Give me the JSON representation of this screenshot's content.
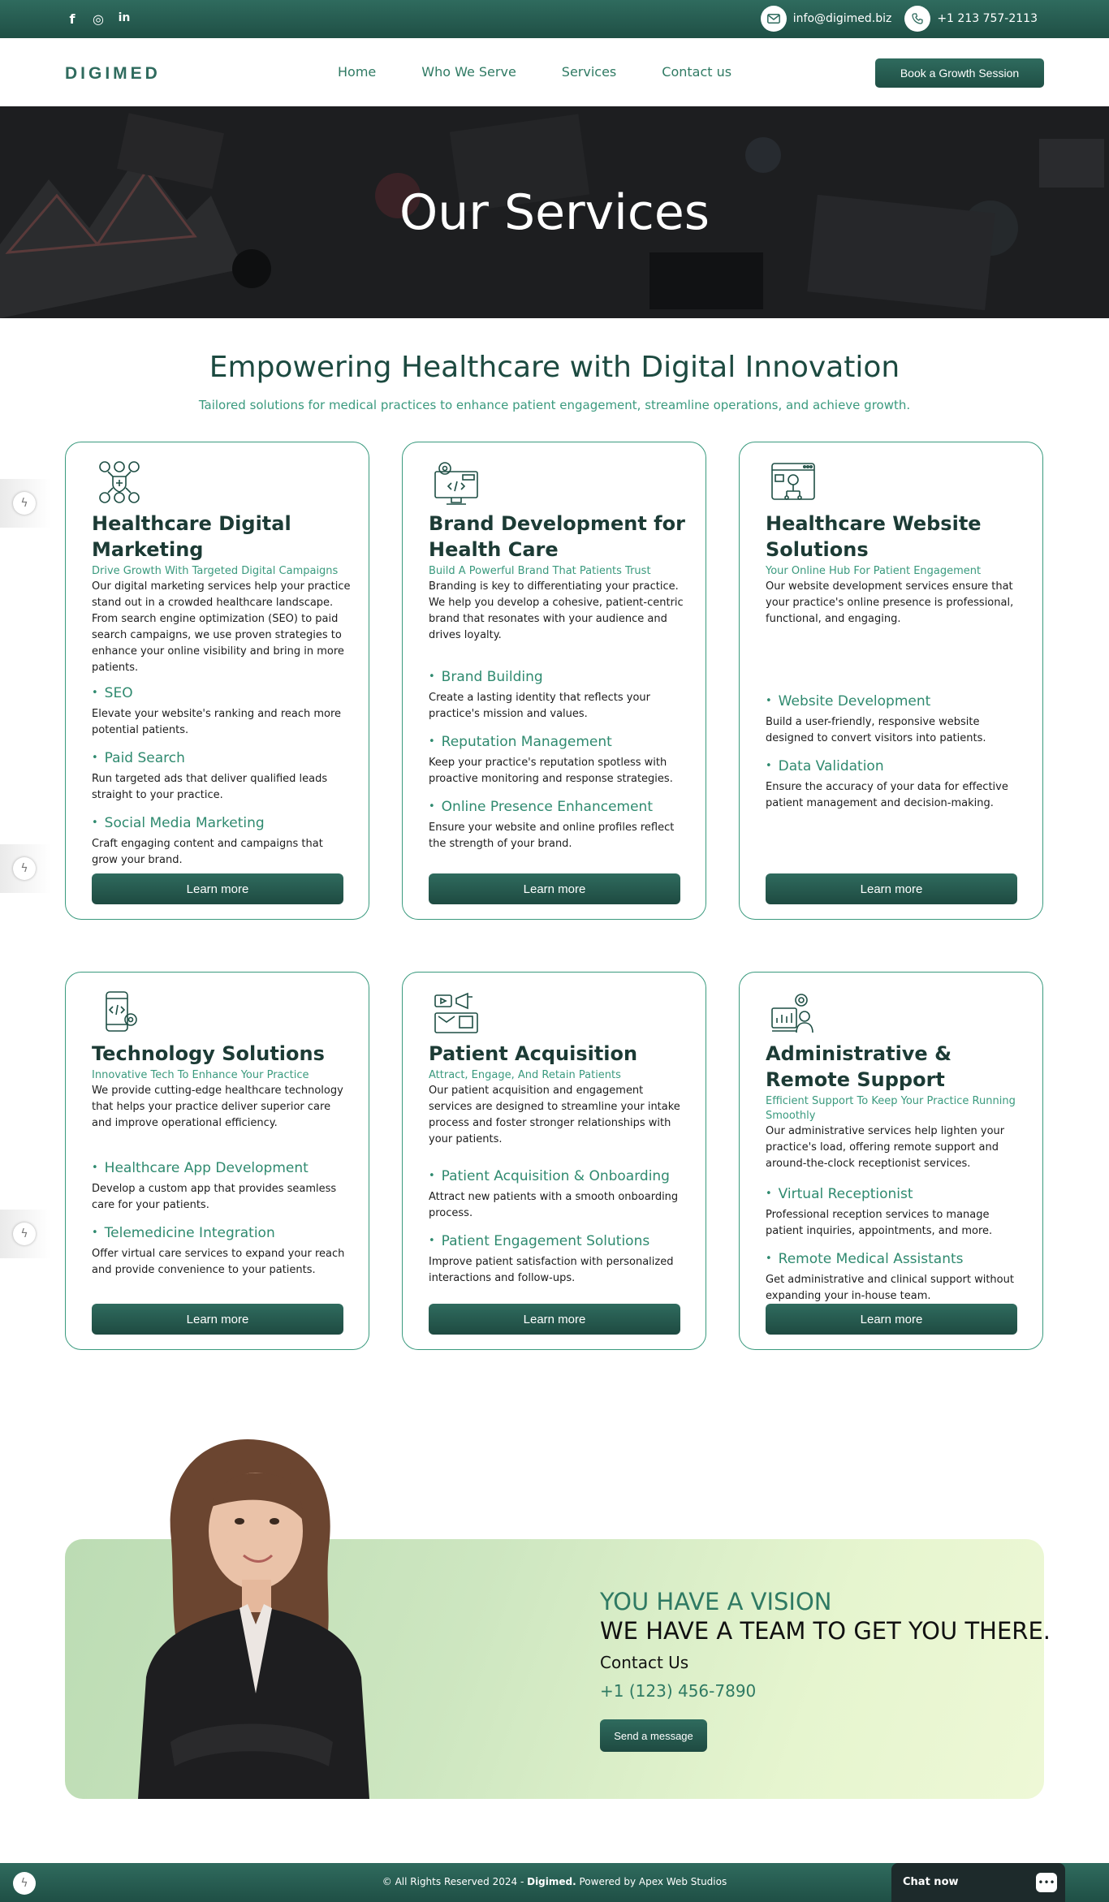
{
  "topbar": {
    "social": [
      {
        "icon": "facebook-icon",
        "glyph": "f"
      },
      {
        "icon": "instagram-icon",
        "glyph": "◎"
      },
      {
        "icon": "linkedin-icon",
        "glyph": "in"
      }
    ],
    "email": "info@digimed.biz",
    "phone": "+1 213 757-2113"
  },
  "navbar": {
    "logo": "DIGIMED",
    "links": [
      "Home",
      "Who We Serve",
      "Services",
      "Contact us"
    ],
    "cta_label": "Book a Growth Session"
  },
  "hero": {
    "title": "Our Services"
  },
  "intro": {
    "title": "Empowering Healthcare with Digital Innovation",
    "subtitle": "Tailored solutions for medical practices to enhance patient engagement, streamline operations, and achieve growth."
  },
  "cards": [
    {
      "icon": "digital-marketing-icon",
      "title": "Healthcare Digital Marketing",
      "subtitle": "Drive Growth With Targeted Digital Campaigns",
      "description": "Our digital marketing services help your practice stand out in a crowded healthcare landscape. From search engine optimization (SEO) to paid search campaigns, we use proven strategies to enhance your online visibility and bring in more patients.",
      "features": [
        {
          "title": "SEO",
          "text": "Elevate your website's ranking and reach more potential patients."
        },
        {
          "title": "Paid Search",
          "text": "Run targeted ads that deliver qualified leads straight to your practice."
        },
        {
          "title": "Social Media Marketing",
          "text": "Craft engaging content and campaigns that grow your brand."
        }
      ],
      "button": "Learn more"
    },
    {
      "icon": "brand-development-icon",
      "title": "Brand Development for Health Care",
      "subtitle": "Build A Powerful Brand That Patients Trust",
      "description": "Branding is key to differentiating your practice. We help you develop a cohesive, patient-centric brand that resonates with your audience and drives loyalty.",
      "features": [
        {
          "title": "Brand Building",
          "text": "Create a lasting identity that reflects your practice's mission and values."
        },
        {
          "title": "Reputation Management",
          "text": "Keep your practice's reputation spotless with proactive monitoring and response strategies."
        },
        {
          "title": "Online Presence Enhancement",
          "text": "Ensure your website and online profiles reflect the strength of your brand."
        }
      ],
      "button": "Learn more"
    },
    {
      "icon": "website-solutions-icon",
      "title": "Healthcare Website Solutions",
      "subtitle": "Your Online Hub For Patient Engagement",
      "description": "Our website development services ensure that your practice's online presence is professional, functional, and engaging.",
      "features": [
        {
          "title": "Website Development",
          "text": "Build a user-friendly, responsive website designed to convert visitors into patients."
        },
        {
          "title": "Data Validation",
          "text": "Ensure the accuracy of your data for effective patient management and decision-making."
        }
      ],
      "button": "Learn more"
    },
    {
      "icon": "technology-solutions-icon",
      "title": "Technology Solutions",
      "subtitle": "Innovative Tech To Enhance Your Practice",
      "description": "We provide cutting-edge healthcare technology that helps your practice deliver superior care and improve operational efficiency.",
      "features": [
        {
          "title": "Healthcare App Development",
          "text": "Develop a custom app that provides seamless care for your patients."
        },
        {
          "title": "Telemedicine Integration",
          "text": "Offer virtual care services to expand your reach and provide convenience to your patients."
        }
      ],
      "button": "Learn more"
    },
    {
      "icon": "patient-acquisition-icon",
      "title": "Patient Acquisition",
      "subtitle": "Attract, Engage, And Retain Patients",
      "description": "Our patient acquisition and engagement services are designed to streamline your intake process and foster stronger relationships with your patients.",
      "features": [
        {
          "title": "Patient Acquisition & Onboarding",
          "text": "Attract new patients with a smooth onboarding process."
        },
        {
          "title": "Patient Engagement Solutions",
          "text": "Improve patient satisfaction with personalized interactions and follow-ups."
        }
      ],
      "button": "Learn more"
    },
    {
      "icon": "administrative-support-icon",
      "title": "Administrative & Remote Support",
      "subtitle": "Efficient Support To Keep Your Practice Running Smoothly",
      "description": "Our administrative services help lighten your practice's load, offering remote support and around-the-clock receptionist services.",
      "features": [
        {
          "title": "Virtual Receptionist",
          "text": "Professional reception services to manage patient inquiries, appointments, and more."
        },
        {
          "title": "Remote Medical Assistants",
          "text": "Get administrative and clinical support without expanding your in-house team."
        }
      ],
      "button": "Learn more"
    }
  ],
  "cta": {
    "vision": "YOU HAVE A VISION",
    "team": "WE HAVE A TEAM TO GET YOU THERE.",
    "contact_label": "Contact Us",
    "phone": "+1 (123) 456-7890",
    "button": "Send a message"
  },
  "footer": {
    "prefix": "© All Rights Reserved 2024 - ",
    "brand": "Digimed.",
    "suffix": " Powered by Apex Web Studios"
  },
  "chat": {
    "label": "Chat now"
  },
  "colors": {
    "primary": "#2f6b5e",
    "accent": "#3a9a7e",
    "dark": "#1c3b35"
  }
}
